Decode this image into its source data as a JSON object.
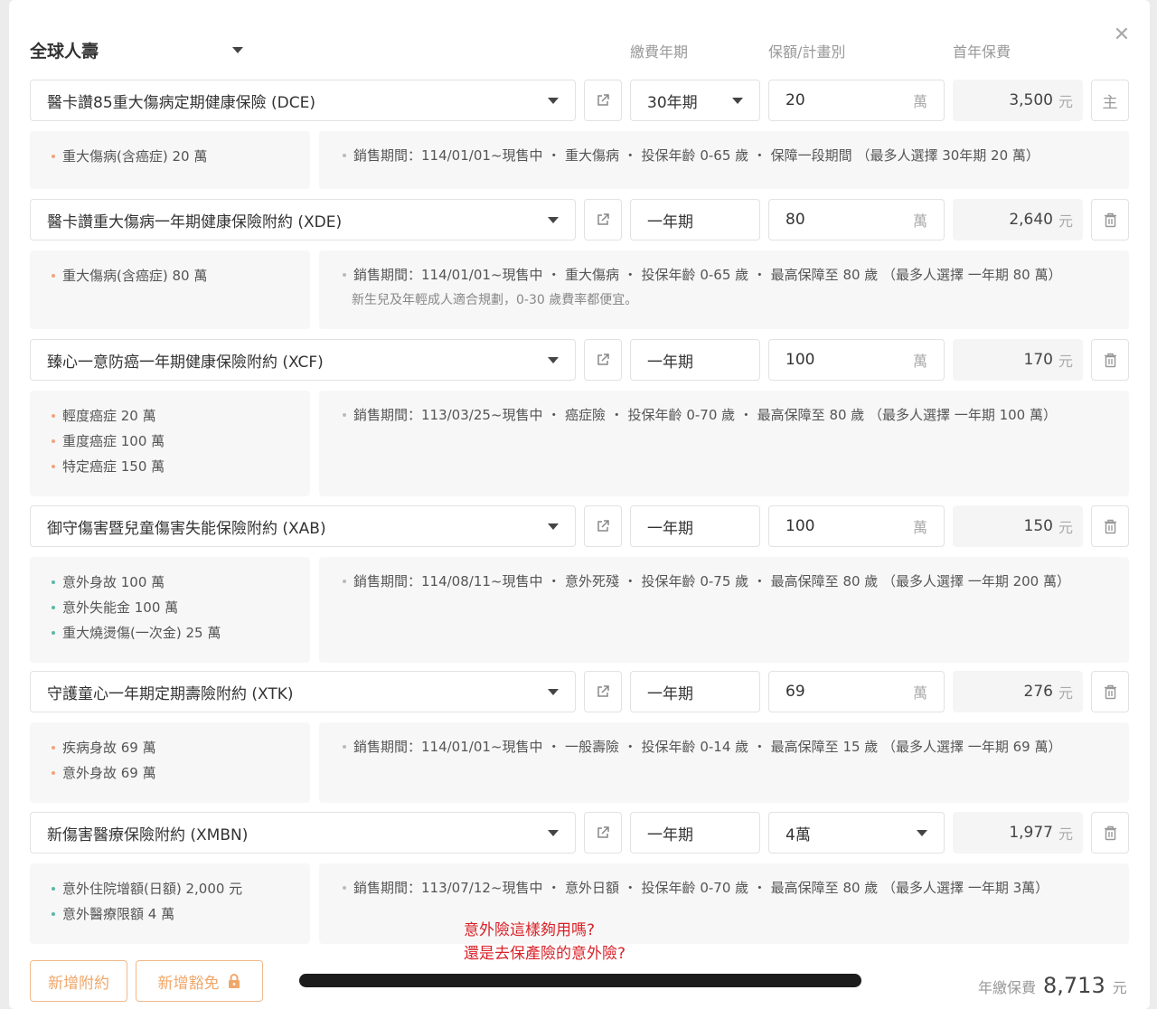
{
  "company": {
    "name": "全球人壽"
  },
  "headers": {
    "term": "繳費年期",
    "amount": "保額/計畫別",
    "premium": "首年保費"
  },
  "colors": {
    "accent": "#f0a76a",
    "note": "#d8232a",
    "dot_orange": "#f3a37f",
    "dot_teal": "#5bb8a8"
  },
  "rows": [
    {
      "product": "醫卡讚85重大傷病定期健康保險 (DCE)",
      "term": "30年期",
      "amount": "20",
      "amount_unit": "萬",
      "premium": "3,500",
      "premium_unit": "元",
      "action": "主",
      "coverage": [
        "重大傷病(含癌症) 20 萬"
      ],
      "info": "銷售期間：114/01/01~現售中 ・ 重大傷病 ・ 投保年齡 0-65 歲 ・ 保障一段期間 （最多人選擇 30年期 20 萬）",
      "info_note": ""
    },
    {
      "product": "醫卡讚重大傷病一年期健康保險附約 (XDE)",
      "term": "一年期",
      "amount": "80",
      "amount_unit": "萬",
      "premium": "2,640",
      "premium_unit": "元",
      "action": "trash-icon",
      "coverage": [
        "重大傷病(含癌症) 80 萬"
      ],
      "info": "銷售期間：114/01/01~現售中 ・ 重大傷病 ・ 投保年齡 0-65 歲 ・ 最高保障至 80 歲 （最多人選擇 一年期 80 萬）",
      "info_note": "新生兒及年輕成人適合規劃，0-30 歲費率都便宜。"
    },
    {
      "product": "臻心一意防癌一年期健康保險附約 (XCF)",
      "term": "一年期",
      "amount": "100",
      "amount_unit": "萬",
      "premium": "170",
      "premium_unit": "元",
      "action": "trash-icon",
      "coverage": [
        "輕度癌症 20 萬",
        "重度癌症 100 萬",
        "特定癌症 150 萬"
      ],
      "info": "銷售期間：113/03/25~現售中 ・ 癌症險 ・ 投保年齡 0-70 歲 ・ 最高保障至 80 歲 （最多人選擇 一年期 100 萬）",
      "info_note": ""
    },
    {
      "product": "御守傷害暨兒童傷害失能保險附約 (XAB)",
      "term": "一年期",
      "amount": "100",
      "amount_unit": "萬",
      "premium": "150",
      "premium_unit": "元",
      "action": "trash-icon",
      "coverage": [
        "意外身故 100 萬",
        "意外失能金 100 萬",
        "重大燒燙傷(一次金) 25 萬"
      ],
      "info": "銷售期間：114/08/11~現售中 ・ 意外死殘 ・ 投保年齡 0-75 歲 ・ 最高保障至 80 歲 （最多人選擇 一年期 200 萬）",
      "info_note": ""
    },
    {
      "product": "守護童心一年期定期壽險附約 (XTK)",
      "term": "一年期",
      "amount": "69",
      "amount_unit": "萬",
      "premium": "276",
      "premium_unit": "元",
      "action": "trash-icon",
      "coverage": [
        "疾病身故 69 萬",
        "意外身故 69 萬"
      ],
      "info": "銷售期間：114/01/01~現售中 ・ 一般壽險 ・ 投保年齡 0-14 歲 ・ 最高保障至 15 歲 （最多人選擇 一年期 69 萬）",
      "info_note": ""
    },
    {
      "product": "新傷害醫療保險附約 (XMBN)",
      "term": "一年期",
      "amount": "4萬",
      "amount_unit": "",
      "premium": "1,977",
      "premium_unit": "元",
      "action": "trash-icon",
      "coverage": [
        "意外住院增額(日額) 2,000 元",
        "意外醫療限額 4 萬"
      ],
      "info": "銷售期間：113/07/12~現售中 ・ 意外日額 ・ 投保年齡 0-70 歲 ・ 最高保障至 80 歲 （最多人選擇 一年期 3萬）",
      "info_note": ""
    }
  ],
  "footer": {
    "add_rider": "新增附約",
    "add_waiver": "新增豁免",
    "note_line1": "意外險這樣夠用嗎?",
    "note_line2": "還是去保產險的意外險?",
    "total_label": "年繳保費",
    "total_value": "8,713",
    "total_unit": "元"
  }
}
